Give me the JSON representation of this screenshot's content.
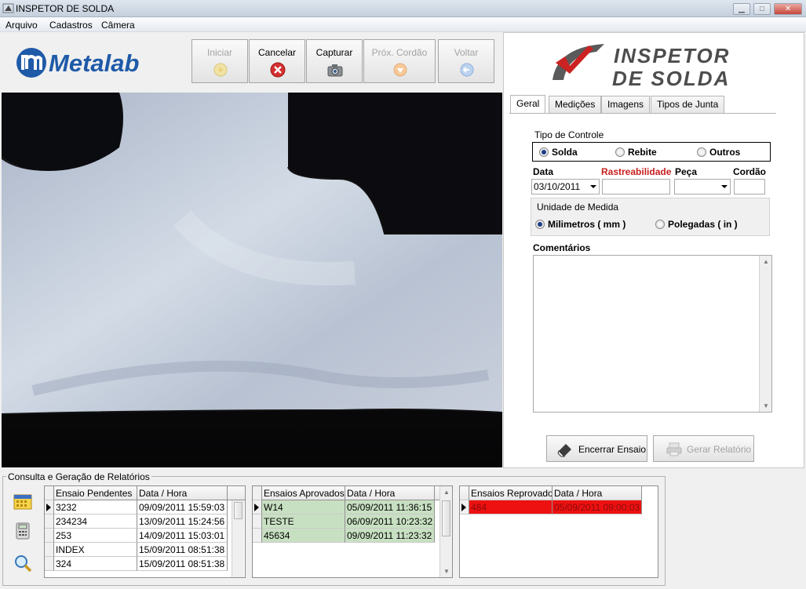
{
  "window": {
    "title": "INSPETOR DE SOLDA"
  },
  "menu": [
    "Arquivo",
    "Cadastros",
    "Câmera"
  ],
  "brand": {
    "logo_text": "Metalab",
    "product_line1": "INSPETOR",
    "product_line2": "DE SOLDA",
    "accent": "#cc2222",
    "logo_blue": "#1f5aa8"
  },
  "toolbar": [
    {
      "label": "Iniciar",
      "enabled": false,
      "icon": "play-icon"
    },
    {
      "label": "Cancelar",
      "enabled": true,
      "icon": "cancel-icon"
    },
    {
      "label": "Capturar",
      "enabled": true,
      "icon": "camera-icon"
    },
    {
      "label": "Próx. Cordão",
      "enabled": false,
      "icon": "next-icon"
    },
    {
      "label": "Voltar",
      "enabled": false,
      "icon": "back-icon"
    }
  ],
  "tabs": [
    "Geral",
    "Medições",
    "Imagens",
    "Tipos de Junta"
  ],
  "form": {
    "tipo_controle": {
      "label": "Tipo de Controle",
      "options": [
        "Solda",
        "Rebite",
        "Outros"
      ],
      "selected": "Solda"
    },
    "data_label": "Data",
    "data_value": "03/10/2011",
    "rastreabilidade_label": "Rastreabilidade",
    "peca_label": "Peça",
    "cordao_label": "Cordão",
    "unidade": {
      "label": "Unidade de Medida",
      "options": [
        "Milimetros ( mm )",
        "Polegadas ( in )"
      ],
      "selected": "Milimetros ( mm )"
    },
    "comentarios_label": "Comentários"
  },
  "actions": {
    "encerrar": "Encerrar Ensaio",
    "gerar": "Gerar Relatório"
  },
  "reports": {
    "group_label": "Consulta e Geração de Relatórios",
    "pendentes": {
      "headers": [
        "Ensaio Pendentes",
        "Data / Hora"
      ],
      "rows": [
        [
          "3232",
          "09/09/2011 15:59:03"
        ],
        [
          "234234",
          "13/09/2011 15:24:56"
        ],
        [
          "253",
          "14/09/2011 15:03:01"
        ],
        [
          "INDEX",
          "15/09/2011 08:51:38"
        ],
        [
          "324",
          "15/09/2011 08:51:38"
        ]
      ]
    },
    "aprovados": {
      "headers": [
        "Ensaios Aprovados",
        "Data / Hora"
      ],
      "rows": [
        [
          "W14",
          "05/09/2011 11:36:15"
        ],
        [
          "TESTE",
          "06/09/2011 10:23:32"
        ],
        [
          "45634",
          "09/09/2011 11:23:32"
        ]
      ]
    },
    "reprovados": {
      "headers": [
        "Ensaios Reprovados",
        "Data / Hora"
      ],
      "rows": [
        [
          "484",
          "05/09/2011 09:00:03"
        ]
      ]
    }
  }
}
